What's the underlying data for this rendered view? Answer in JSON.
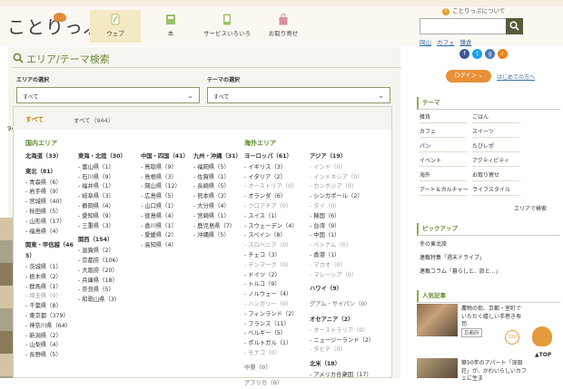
{
  "header": {
    "logo": "ことりっぷ",
    "about": "ことりっぷについて",
    "nav": [
      {
        "label": "ウェブ",
        "icon": "pen-icon"
      },
      {
        "label": "本",
        "icon": "book-icon"
      },
      {
        "label": "サービスいろいろ",
        "icon": "phone-icon"
      },
      {
        "label": "お取り寄せ",
        "icon": "bag-icon"
      }
    ],
    "search_button_icon": "search-icon",
    "quick_links": [
      "岡山",
      "カフェ",
      "鎌倉"
    ]
  },
  "search_panel": {
    "title": "エリア/テーマ検索",
    "area_label": "エリアの選択",
    "area_value": "すべて",
    "theme_label": "テーマの選択",
    "theme_value": "すべて",
    "side_count": "94",
    "dropdown": {
      "all_label": "すべて",
      "all_count": "すべて（944）",
      "domestic_heading": "国内エリア",
      "overseas_heading": "海外エリア",
      "col1": [
        "北海道（33）",
        "",
        "東北（81）",
        "- 青森県（6）",
        "- 岩手県（9）",
        "- 宮城県（40）",
        "- 秋田県（5）",
        "- 山形県（17）",
        "- 福島県（4）",
        "",
        "関東・甲信越（46",
        "5）",
        "- 茨城県（1）",
        "- 栃木県（2）",
        "- 群馬県（1）",
        "- 埼玉県（0）",
        "- 千葉県（8）",
        "- 東京都（379）",
        "- 神奈川県（64）",
        "- 新潟県（2）",
        "- 山梨県（4）",
        "- 長野県（5）"
      ],
      "col2": [
        "東海・北陸（30）",
        "- 富山県（1）",
        "- 石川県（9）",
        "- 福井県（1）",
        "- 岐阜県（3）",
        "- 静岡県（4）",
        "- 愛知県（9）",
        "- 三重県（3）",
        "",
        "関西（154）",
        "- 滋賀県（2）",
        "- 京都府（106）",
        "- 大阪府（20）",
        "- 兵庫県（18）",
        "- 奈良県（5）",
        "- 和歌山県（3）"
      ],
      "col3": [
        "中国・四国（41）",
        "- 鳥取県（9）",
        "- 島根県（3）",
        "- 岡山県（12）",
        "- 広島県（5）",
        "- 山口県（1）",
        "- 徳島県（4）",
        "- 香川県（1）",
        "- 愛媛県（2）",
        "- 高知県（4）"
      ],
      "col4": [
        "九州・沖縄（31）",
        "- 福岡県（5）",
        "- 佐賀県（1）",
        "- 長崎県（5）",
        "- 熊本県（3）",
        "- 大分県（4）",
        "- 宮崎県（1）",
        "- 鹿児島県（7）",
        "- 沖縄県（5）"
      ],
      "col5": [
        "ヨーロッパ（61）",
        "- イギリス（3）",
        "- イタリア（2）",
        "- オーストリア（0）",
        "- オランダ（6）",
        "- クロアチア（0）",
        "- スイス（1）",
        "- スウェーデン（4）",
        "- スペイン（8）",
        "- スロベニア（0）",
        "- チェコ（3）",
        "- デンマーク（0）",
        "- ドイツ（2）",
        "- トルコ（9）",
        "- ノルウェー（4）",
        "- ハンガリー（0）",
        "- フィンランド（2）",
        "- フランス（11）",
        "- ベルギー（5）",
        "- ポルトガル（1）",
        "- モナコ（0）",
        "",
        "中東（0）",
        "",
        "アフリカ（0）"
      ],
      "col6": [
        "アジア（19）",
        "- インド（0）",
        "- インドネシア（0）",
        "- カンボジア（0）",
        "- シンガポール（2）",
        "- タイ（0）",
        "- 韓国（6）",
        "- 台湾（9）",
        "- 中国（1）",
        "- ベトナム（0）",
        "- 香港（1）",
        "- マカオ（0）",
        "- マレーシア（0）",
        "",
        "ハワイ（9）",
        "",
        "グアム・サイパン（0）",
        "",
        "オセアニア（2）",
        "- オーストラリア（0）",
        "- ニュージーランド（2）",
        "- タヒチ（0）",
        "",
        "北米（18）",
        "- アメリカ合衆国（17）"
      ]
    }
  },
  "sidebar": {
    "login": "ログイン",
    "first_time": "はじめての方へ",
    "sns": [
      "f",
      "t",
      "g",
      "r"
    ],
    "theme_heading": "テーマ",
    "themes_left": [
      "雑貨",
      "カフェ",
      "パン",
      "イベント",
      "海外",
      "アート＆カルチャー"
    ],
    "themes_right": [
      "ごはん",
      "スイーツ",
      "たびレポ",
      "アクティビティ",
      "お取り寄せ",
      "ライフスタイル"
    ],
    "theme_more": "エリアで検索",
    "pickup_heading": "ピックアップ",
    "pickups": [
      "冬の東北旅",
      "連載特集「週末ドライブ」",
      "連載コラム「暮らしと、旅と…」"
    ],
    "popular_heading": "人気記事",
    "popular": [
      {
        "title": "農物の街、京都・室町でいただく嬉しい手巻き寿司",
        "tag": "京都府"
      },
      {
        "title": "築50年のアパート「深田荘」が、かわいらしいカフェに生ま",
        "tag": ""
      }
    ],
    "badge": "100",
    "top": "TOP"
  },
  "colors": {
    "accent": "#6a8a3a",
    "orange": "#e8913a",
    "nav_active": "#f3e9c4"
  }
}
